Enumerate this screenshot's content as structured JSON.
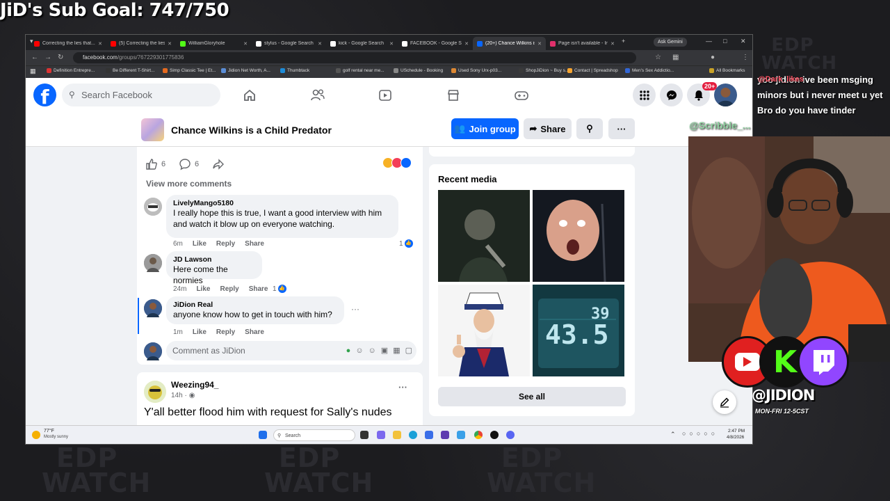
{
  "stream": {
    "sub_goal": "JiD's Sub Goal: 747/750",
    "watermark": "EDP WATCH",
    "chat_messages": [
      {
        "user": "@Dark_likes",
        "text": "yoo jidion ive been msging minors but i never meet u yet"
      },
      {
        "user": "",
        "text": "Bro do you have tinder"
      }
    ],
    "chat_next_user": "@Scribble_...",
    "handle": "@JIDION",
    "schedule": "MON-FRI 12-5CST",
    "socials": [
      "youtube-icon",
      "kick-icon",
      "twitch-icon"
    ]
  },
  "browser": {
    "tabs": [
      {
        "label": "Correcting the lies that...",
        "icon": "youtube-icon",
        "color": "#ff0000",
        "active": false
      },
      {
        "label": "(5) Correcting the lies ti...",
        "icon": "youtube-icon",
        "color": "#ff0000",
        "active": false
      },
      {
        "label": "WilliamGloryhole",
        "icon": "kick-icon",
        "color": "#53fc18",
        "active": false
      },
      {
        "label": "stylus - Google Search",
        "icon": "google-icon",
        "color": "#ffffff",
        "active": false
      },
      {
        "label": "kick - Google Search",
        "icon": "google-icon",
        "color": "#ffffff",
        "active": false
      },
      {
        "label": "FACEBOOK - Google Se...",
        "icon": "google-icon",
        "color": "#ffffff",
        "active": false
      },
      {
        "label": "(20+) Chance Wilkins is...",
        "icon": "facebook-icon",
        "color": "#0866ff",
        "active": true
      },
      {
        "label": "Page isn't available - In...",
        "icon": "instagram-icon",
        "color": "#e1306c",
        "active": false
      }
    ],
    "ask_gemini": "Ask Gemini",
    "url_host": "facebook.com",
    "url_path": "/groups/767229301775836",
    "bookmarks": [
      "Definition Entrepre...",
      "Be Different T-Shirt...",
      "Simp Classic Tee | Et...",
      "Jidion Net Worth, A...",
      "Thumbtack",
      "golf rental near me...",
      "USchedule - Booking",
      "Used Sony Urx-p03...",
      "ShopJiDion ~ Buy s...",
      "Contact | Spreadshop",
      "Men's Sex Addictio...",
      "All Bookmarks"
    ]
  },
  "fb": {
    "search_placeholder": "Search Facebook",
    "notif_badge": "20+",
    "group_name": "Chance Wilkins is a Child Predator",
    "join_label": "Join group",
    "share_label": "Share",
    "post": {
      "like_count": "6",
      "comment_count": "6",
      "view_more": "View more comments",
      "comments": [
        {
          "name": "LivelyMango5180",
          "text": "I really hope this is true, I want a good interview with him and watch it blow up on everyone watching.",
          "time": "6m",
          "likes": "1"
        },
        {
          "name": "JD Lawson",
          "text": "Here come the normies",
          "time": "24m",
          "likes": "1"
        },
        {
          "name": "JiDion Real",
          "text": "anyone know how to get in touch with him?",
          "time": "1m",
          "likes": ""
        }
      ],
      "like": "Like",
      "reply": "Reply",
      "share": "Share",
      "composer_placeholder": "Comment as JiDion"
    },
    "post2": {
      "author": "Weezing94_",
      "time": "14h ·",
      "text": "Y'all better flood him with request for Sally's nudes"
    },
    "recent_media": {
      "title": "Recent media",
      "see_all": "See all",
      "weather_reading": "43.5",
      "weather_humidity": "39"
    }
  },
  "taskbar": {
    "weather_temp": "77°F",
    "weather_desc": "Mostly sunny",
    "search_label": "Search",
    "time": "2:47 PM",
    "date": "4/8/2026"
  }
}
